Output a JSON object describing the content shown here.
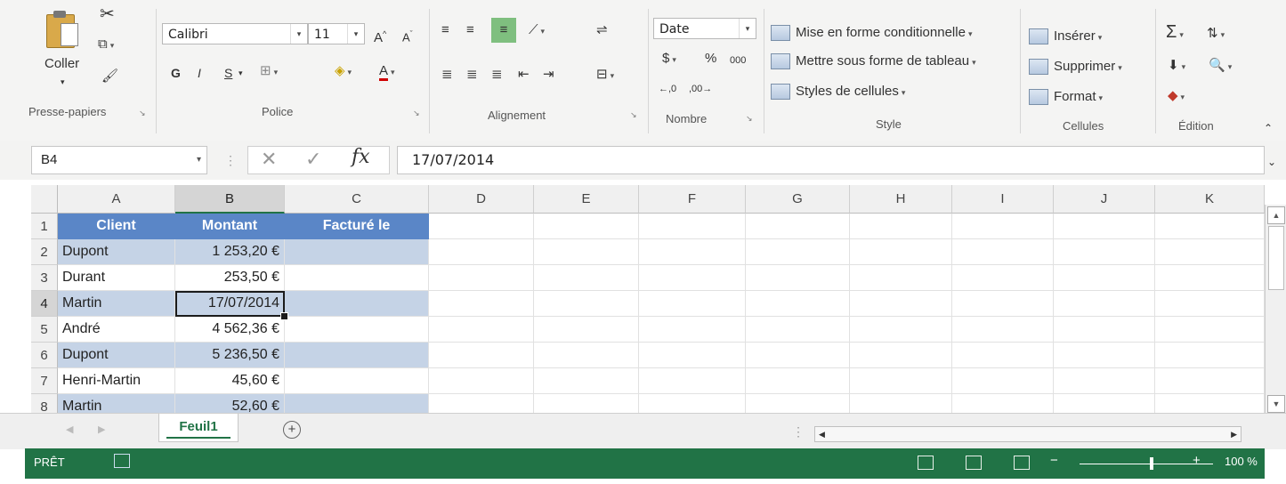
{
  "ribbon": {
    "clipboard": {
      "paste_label": "Coller",
      "group_label": "Presse-papiers"
    },
    "font": {
      "name": "Calibri",
      "size": "11",
      "bold": "G",
      "italic": "I",
      "underline": "S",
      "group_label": "Police"
    },
    "alignment": {
      "group_label": "Alignement"
    },
    "number": {
      "format": "Date",
      "currency": "$",
      "percent": "%",
      "thousands": "000",
      "group_label": "Nombre"
    },
    "style": {
      "conditional": "Mise en forme conditionnelle",
      "as_table": "Mettre sous forme de tableau",
      "cell_styles": "Styles de cellules",
      "group_label": "Style"
    },
    "cells": {
      "insert": "Insérer",
      "delete": "Supprimer",
      "format": "Format",
      "group_label": "Cellules"
    },
    "editing": {
      "group_label": "Édition"
    }
  },
  "formula_bar": {
    "name_box": "B4",
    "content": "17/07/2014",
    "fx": "fx"
  },
  "columns": [
    "A",
    "B",
    "C",
    "D",
    "E",
    "F",
    "G",
    "H",
    "I",
    "J",
    "K"
  ],
  "rows": [
    "1",
    "2",
    "3",
    "4",
    "5",
    "6",
    "7",
    "8"
  ],
  "table": {
    "headers": [
      "Client",
      "Montant",
      "Facturé le"
    ],
    "data": [
      [
        "Dupont",
        "1 253,20 €",
        ""
      ],
      [
        "Durant",
        "253,50 €",
        ""
      ],
      [
        "Martin",
        "17/07/2014",
        ""
      ],
      [
        "André",
        "4 562,36 €",
        ""
      ],
      [
        "Dupont",
        "5 236,50 €",
        ""
      ],
      [
        "Henri-Martin",
        "45,60 €",
        ""
      ],
      [
        "Martin",
        "52,60 €",
        ""
      ]
    ]
  },
  "sheet_tab": "Feuil1",
  "status": {
    "ready": "PRÊT",
    "zoom": "100 %"
  }
}
